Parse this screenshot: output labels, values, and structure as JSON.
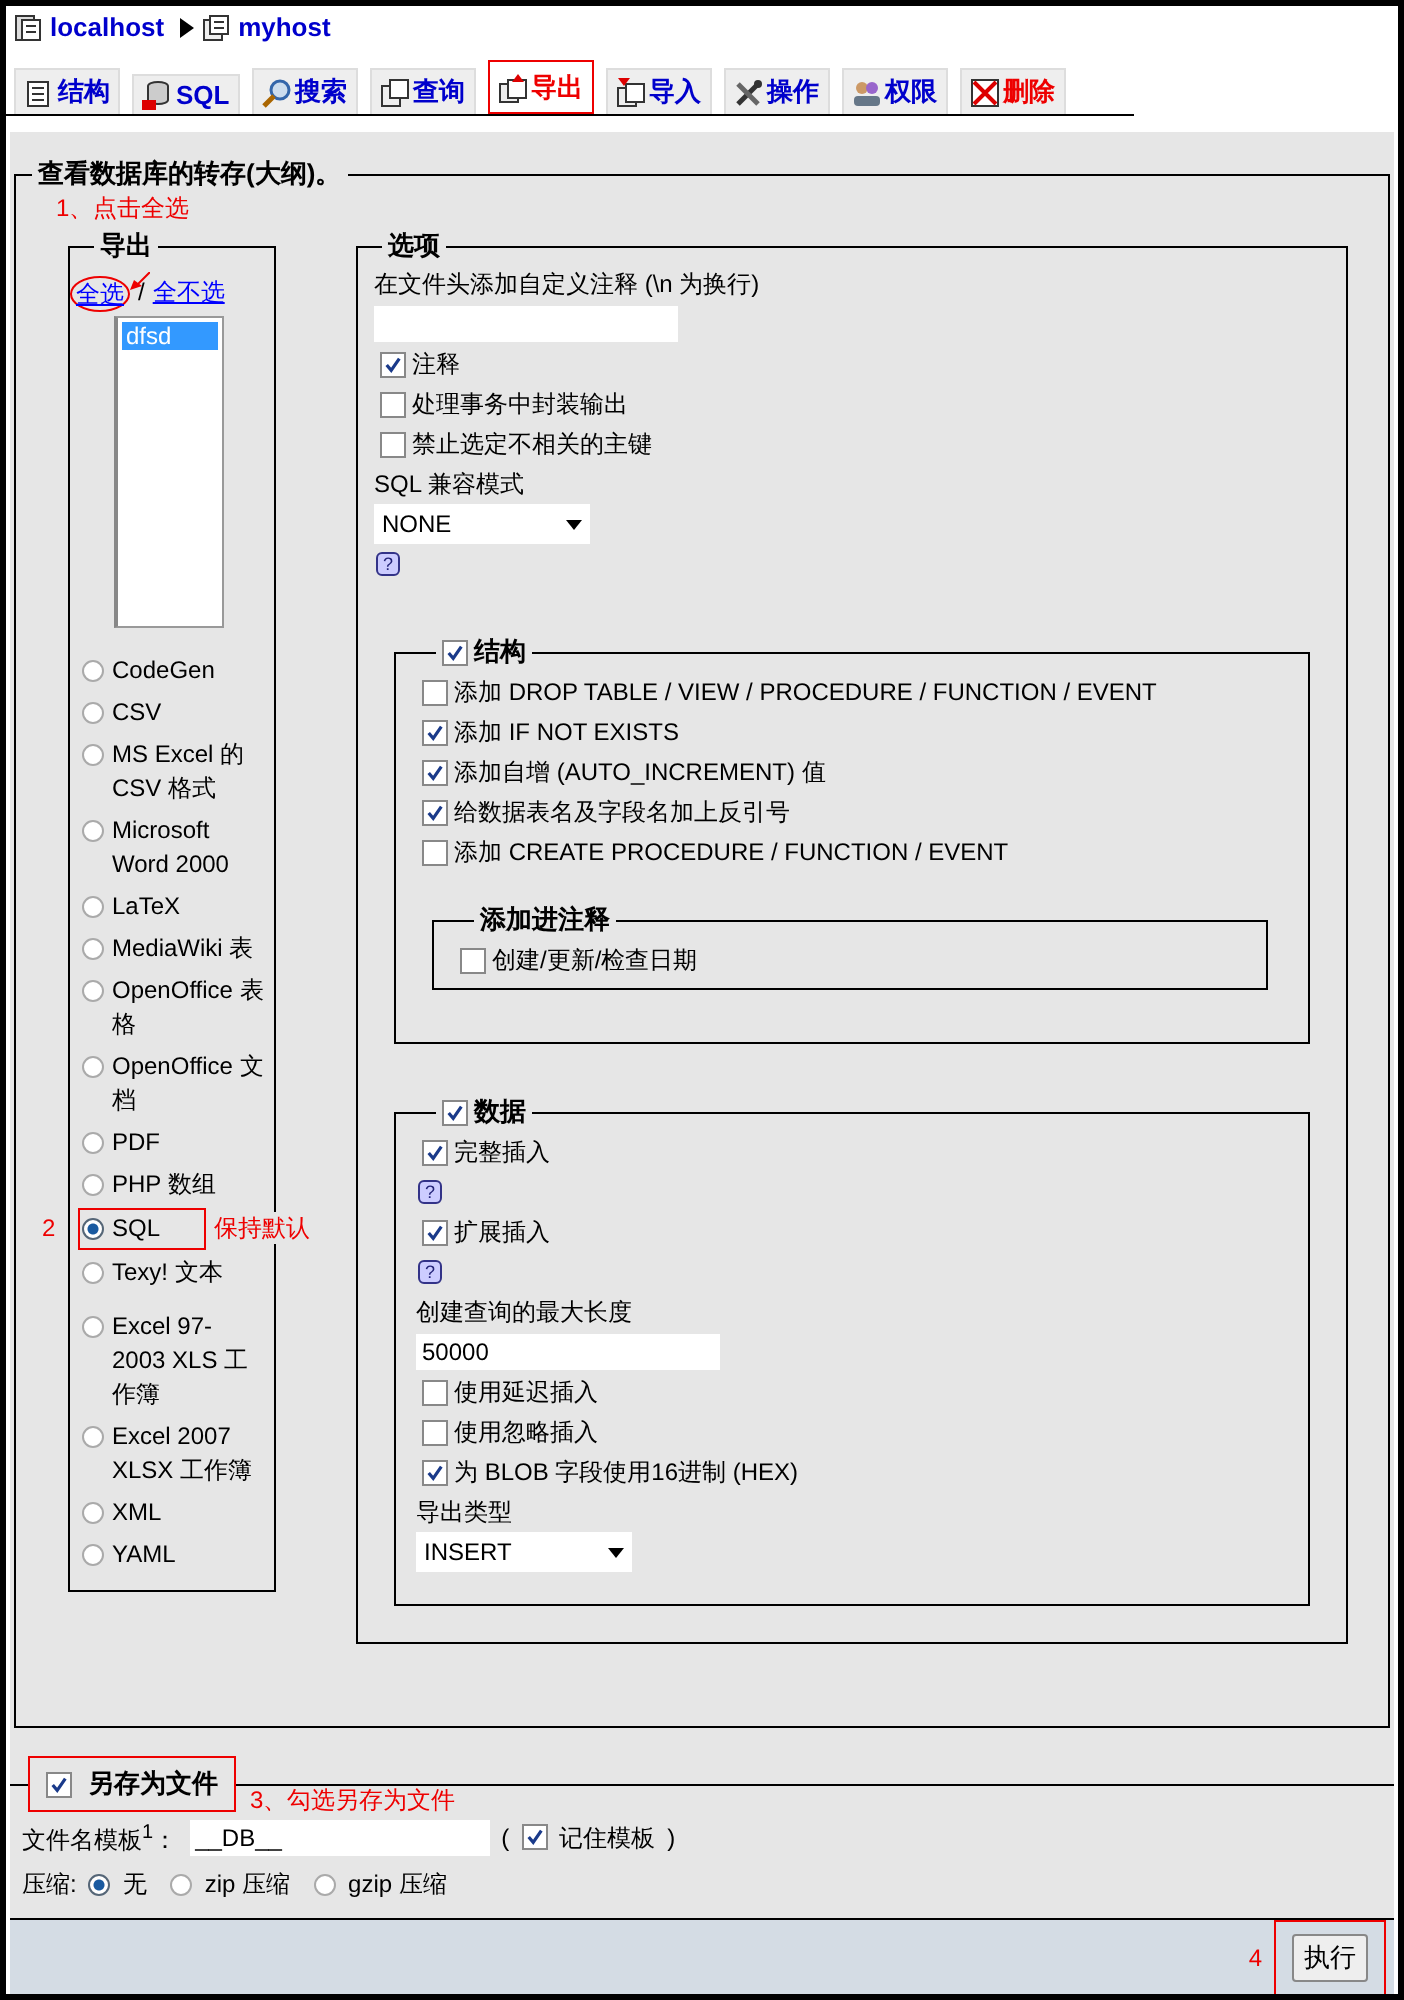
{
  "breadcrumb": {
    "server": "localhost",
    "database": "myhost"
  },
  "tabs": [
    {
      "label": "结构",
      "selected": false,
      "kind": "normal"
    },
    {
      "label": "SQL",
      "selected": false,
      "kind": "normal"
    },
    {
      "label": "搜索",
      "selected": false,
      "kind": "normal"
    },
    {
      "label": "查询",
      "selected": false,
      "kind": "normal"
    },
    {
      "label": "导出",
      "selected": true,
      "kind": "normal"
    },
    {
      "label": "导入",
      "selected": false,
      "kind": "normal"
    },
    {
      "label": "操作",
      "selected": false,
      "kind": "normal"
    },
    {
      "label": "权限",
      "selected": false,
      "kind": "normal"
    },
    {
      "label": "删除",
      "selected": false,
      "kind": "danger"
    }
  ],
  "dump": {
    "title": "查看数据库的转存(大纲)。",
    "export": {
      "note": "1、点击全选",
      "title": "导出",
      "select_all": "全选",
      "separator": "/",
      "select_none": "全不选",
      "tables": [
        {
          "text": "dfsd",
          "selected": true
        }
      ],
      "formats": [
        {
          "label": "CodeGen",
          "selected": false
        },
        {
          "label": "CSV",
          "selected": false
        },
        {
          "label": "MS Excel 的 CSV 格式",
          "selected": false
        },
        {
          "label": "Microsoft Word 2000",
          "selected": false
        },
        {
          "label": "LaTeX",
          "selected": false
        },
        {
          "label": "MediaWiki 表",
          "selected": false
        },
        {
          "label": "OpenOffice 表格",
          "selected": false
        },
        {
          "label": "OpenOffice 文档",
          "selected": false
        },
        {
          "label": "PDF",
          "selected": false
        },
        {
          "label": "PHP 数组",
          "selected": false
        },
        {
          "label": "SQL",
          "selected": true,
          "note_number": "2",
          "note": "保持默认"
        },
        {
          "label": "Texy! 文本",
          "selected": false
        },
        {
          "label": "Excel 97-2003 XLS 工作簿",
          "selected": false
        },
        {
          "label": "Excel 2007 XLSX 工作簿",
          "selected": false
        },
        {
          "label": "XML",
          "selected": false
        },
        {
          "label": "YAML",
          "selected": false
        }
      ]
    },
    "options": {
      "title": "选项",
      "items": [
        {
          "kind": "label",
          "text": "在文件头添加自定义注释 (\\n 为换行)"
        },
        {
          "kind": "input"
        },
        {
          "kind": "checkbox",
          "text": "注释",
          "checked": true
        },
        {
          "kind": "checkbox",
          "text": "处理事务中封装输出",
          "checked": false
        },
        {
          "kind": "checkbox",
          "text": "禁止选定不相关的主键",
          "checked": false
        },
        {
          "kind": "label",
          "text": "SQL 兼容模式"
        },
        {
          "kind": "select",
          "value": "NONE"
        },
        {
          "kind": "help",
          "text": "?"
        },
        {
          "kind": "group",
          "title": "结构",
          "checked": true,
          "items": [
            {
              "kind": "checkbox",
              "text": "添加 DROP TABLE / VIEW / PROCEDURE / FUNCTION / EVENT",
              "checked": false
            },
            {
              "kind": "checkbox",
              "text": "添加 IF NOT EXISTS",
              "checked": true
            },
            {
              "kind": "checkbox",
              "text": "添加自增 (AUTO_INCREMENT) 值",
              "checked": true
            },
            {
              "kind": "checkbox",
              "text": "给数据表名及字段名加上反引号",
              "checked": true
            },
            {
              "kind": "checkbox",
              "text": "添加 CREATE PROCEDURE / FUNCTION / EVENT",
              "checked": false
            },
            {
              "kind": "group",
              "title": "添加进注释",
              "items": [
                {
                  "kind": "checkbox",
                  "text": "创建/更新/检查日期",
                  "checked": false
                }
              ]
            }
          ]
        },
        {
          "kind": "group",
          "title": "数据",
          "checked": true,
          "items": [
            {
              "kind": "checkbox",
              "text": "完整插入",
              "checked": true
            },
            {
              "kind": "help",
              "text": "?"
            },
            {
              "kind": "checkbox",
              "text": "扩展插入",
              "checked": true
            },
            {
              "kind": "help",
              "text": "?"
            },
            {
              "kind": "label",
              "text": "创建查询的最大长度"
            },
            {
              "kind": "input",
              "value": "50000"
            },
            {
              "kind": "checkbox",
              "text": "使用延迟插入",
              "checked": false
            },
            {
              "kind": "checkbox",
              "text": "使用忽略插入",
              "checked": false
            },
            {
              "kind": "checkbox",
              "text": "为 BLOB 字段使用16进制 (HEX)",
              "checked": true
            },
            {
              "kind": "label",
              "text": "导出类型"
            },
            {
              "kind": "select",
              "value": "INSERT"
            }
          ]
        }
      ]
    }
  },
  "save_file": {
    "title": "另存为文件",
    "checked": true,
    "highlight": true,
    "note": "3、勾选另存为文件",
    "template_label": "文件名模板$^{1}$：",
    "template_value": "__DB__",
    "open_paren": "(",
    "remember_label": "记住模板",
    "remember_checked": true,
    "close_paren": ")",
    "compression_label": "压缩:",
    "compression": [
      {
        "label": "无",
        "selected": true
      },
      {
        "label": "zip 压缩",
        "selected": false
      },
      {
        "label": "gzip 压缩",
        "selected": false
      }
    ]
  },
  "footer": {
    "note": "4",
    "button": "执行",
    "highlight": true
  }
}
